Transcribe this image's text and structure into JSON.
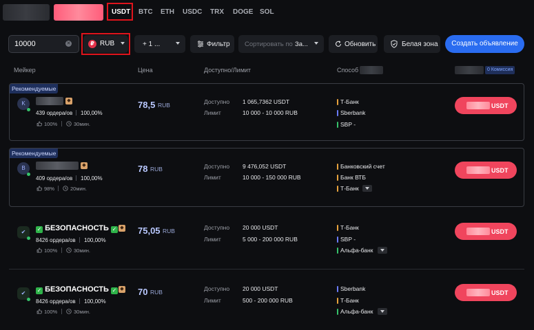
{
  "coins": [
    "USDT",
    "BTC",
    "ETH",
    "USDC",
    "TRX",
    "DOGE",
    "SOL"
  ],
  "filters": {
    "amount_value": "10000",
    "currency": "RUB",
    "currency_symbol": "₽",
    "payment_label": "+ 1 ...",
    "filter_label": "Фильтр",
    "sort_placeholder": "Сортировать по",
    "sort_value": "За...",
    "refresh_label": "Обновить",
    "white_zone_label": "Белая зона",
    "create_label": "Создать объявление"
  },
  "headers": {
    "maker": "Мейкер",
    "price": "Цена",
    "available": "Доступно/Лимит",
    "method": "Способ",
    "fee": "0 Комиссия"
  },
  "labels": {
    "recommended": "Рекомендуемые",
    "available": "Доступно",
    "limit": "Лимит",
    "buy_suffix": "USDT"
  },
  "offers": [
    {
      "avatar": "K",
      "name": "",
      "orders": "439 ордера/ов",
      "completion": "100,00%",
      "rating": "100%",
      "time": "30мин.",
      "price": "78,5",
      "price_currency": "RUB",
      "available": "1 065,7362 USDT",
      "limit": "10 000 - 10 000 RUB",
      "methods": [
        "Т-Банк",
        "Sberbank",
        "SBP -"
      ]
    },
    {
      "avatar": "B",
      "name": "",
      "orders": "409 ордера/ов",
      "completion": "100,00%",
      "rating": "98%",
      "time": "20мин.",
      "price": "78",
      "price_currency": "RUB",
      "available": "9 476,052 USDT",
      "limit": "10 000 - 150 000 RUB",
      "methods": [
        "Банковский счет",
        "Банк ВТБ",
        "Т-Банк"
      ]
    },
    {
      "avatar": "✔",
      "name": "БЕЗОПАСНОСТЬ",
      "orders": "8426 ордера/ов",
      "completion": "100,00%",
      "rating": "100%",
      "time": "30мин.",
      "price": "75,05",
      "price_currency": "RUB",
      "available": "20 000 USDT",
      "limit": "5 000 - 200 000 RUB",
      "methods": [
        "Т-Банк",
        "SBP -",
        "Альфа-банк"
      ]
    },
    {
      "avatar": "✔",
      "name": "БЕЗОПАСНОСТЬ",
      "orders": "8426 ордера/ов",
      "completion": "100,00%",
      "rating": "100%",
      "time": "30мин.",
      "price": "70",
      "price_currency": "RUB",
      "available": "20 000 USDT",
      "limit": "500 - 200 000 RUB",
      "methods": [
        "Sberbank",
        "Т-Банк",
        "Альфа-банк"
      ]
    }
  ]
}
